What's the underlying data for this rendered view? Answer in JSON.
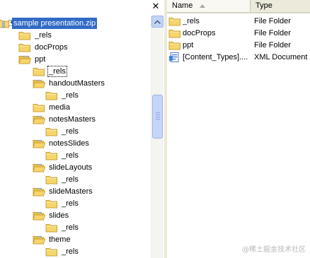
{
  "tree": {
    "close_glyph": "✕",
    "items": [
      {
        "label": "sample presentation.zip",
        "icon": "zip-folder-icon",
        "expander": "+",
        "selected": true
      },
      {
        "label": "_rels",
        "icon": "folder-icon"
      },
      {
        "label": "docProps",
        "icon": "folder-icon"
      },
      {
        "label": "ppt",
        "icon": "folder-open-icon",
        "expander": "−"
      },
      {
        "label": "_rels",
        "icon": "folder-icon",
        "focused": true
      },
      {
        "label": "handoutMasters",
        "icon": "folder-open-icon",
        "expander": "−"
      },
      {
        "label": "_rels",
        "icon": "folder-icon"
      },
      {
        "label": "media",
        "icon": "folder-icon"
      },
      {
        "label": "notesMasters",
        "icon": "folder-open-icon",
        "expander": "−"
      },
      {
        "label": "_rels",
        "icon": "folder-icon"
      },
      {
        "label": "notesSlides",
        "icon": "folder-open-icon",
        "expander": "−"
      },
      {
        "label": "_rels",
        "icon": "folder-icon"
      },
      {
        "label": "slideLayouts",
        "icon": "folder-open-icon",
        "expander": "−"
      },
      {
        "label": "_rels",
        "icon": "folder-icon"
      },
      {
        "label": "slideMasters",
        "icon": "folder-open-icon",
        "expander": "−"
      },
      {
        "label": "_rels",
        "icon": "folder-icon"
      },
      {
        "label": "slides",
        "icon": "folder-open-icon",
        "expander": "−"
      },
      {
        "label": "_rels",
        "icon": "folder-icon"
      },
      {
        "label": "theme",
        "icon": "folder-open-icon",
        "expander": "−"
      },
      {
        "label": "_rels",
        "icon": "folder-icon"
      }
    ]
  },
  "list": {
    "columns": {
      "name": "Name",
      "type": "Type"
    },
    "rows": [
      {
        "name": "_rels",
        "type": "File Folder",
        "icon": "folder-icon"
      },
      {
        "name": "docProps",
        "type": "File Folder",
        "icon": "folder-icon"
      },
      {
        "name": "ppt",
        "type": "File Folder",
        "icon": "folder-icon"
      },
      {
        "name": "[Content_Types]....",
        "type": "XML Document",
        "icon": "xml-document-icon"
      }
    ]
  },
  "watermark": "@稀土掘金技术社区",
  "colors": {
    "selection": "#316ac5",
    "folder": "#f6d66a",
    "folder_edge": "#c9a13a"
  }
}
